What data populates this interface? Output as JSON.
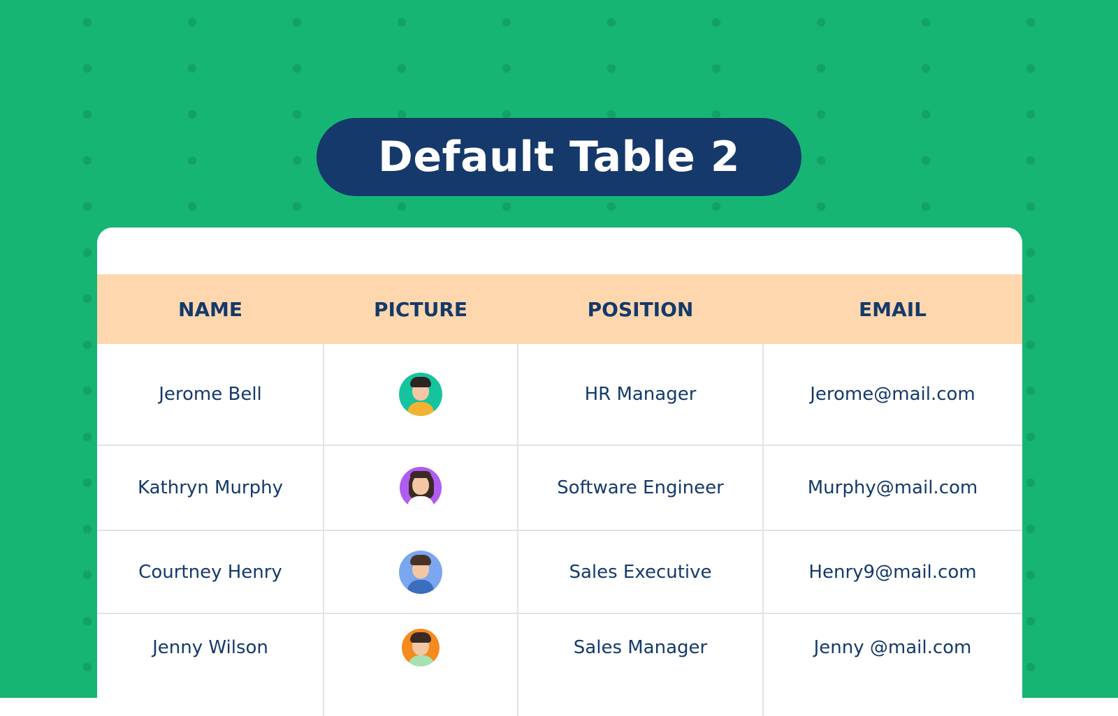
{
  "title": "Default Table 2",
  "colors": {
    "background": "#17b574",
    "title_pill": "#15396a",
    "header_row": "#fed7ae",
    "text": "#15396a"
  },
  "table": {
    "headers": [
      "NAME",
      "PICTURE",
      "POSITION",
      "EMAIL"
    ],
    "rows": [
      {
        "name": "Jerome Bell",
        "avatar": "male-avatar-icon",
        "avatar_bg": "#16c39f",
        "position": "HR Manager",
        "email": "Jerome@mail.com"
      },
      {
        "name": "Kathryn Murphy",
        "avatar": "female-avatar-icon",
        "avatar_bg": "#b05cf0",
        "position": "Software Engineer",
        "email": "Murphy@mail.com"
      },
      {
        "name": "Courtney Henry",
        "avatar": "male-avatar-icon",
        "avatar_bg": "#7aa7ef",
        "position": "Sales Executive",
        "email": "Henry9@mail.com"
      },
      {
        "name": "Jenny Wilson",
        "avatar": "male-avatar-icon",
        "avatar_bg": "#f58a1f",
        "position": "Sales Manager",
        "email": "Jenny @mail.com"
      }
    ]
  }
}
